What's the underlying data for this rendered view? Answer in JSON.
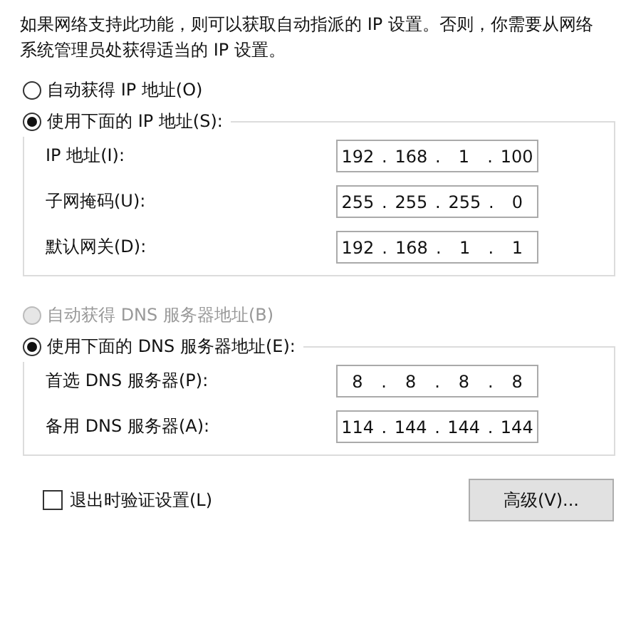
{
  "intro": "如果网络支持此功能，则可以获取自动指派的 IP 设置。否则，你需要从网络系统管理员处获得适当的 IP 设置。",
  "sections": [
    {
      "auto_option": {
        "label": "自动获得 IP 地址(O)",
        "selected": false,
        "disabled": false
      },
      "manual_option": {
        "label": "使用下面的 IP 地址(S):",
        "selected": true,
        "disabled": false
      },
      "fields": [
        {
          "label": "IP 地址(I):",
          "parts": [
            "192",
            ".",
            "168",
            ".",
            "1",
            ".",
            "100"
          ]
        },
        {
          "label": "子网掩码(U):",
          "parts": [
            "255",
            ".",
            "255",
            ".",
            "255",
            ".",
            "0"
          ]
        },
        {
          "label": "默认网关(D):",
          "parts": [
            "192",
            ".",
            "168",
            ".",
            "1",
            ".",
            "1"
          ]
        }
      ]
    },
    {
      "auto_option": {
        "label": "自动获得 DNS 服务器地址(B)",
        "selected": false,
        "disabled": true
      },
      "manual_option": {
        "label": "使用下面的 DNS 服务器地址(E):",
        "selected": true,
        "disabled": false
      },
      "fields": [
        {
          "label": "首选 DNS 服务器(P):",
          "parts": [
            "8",
            ".",
            "8",
            ".",
            "8",
            ".",
            "8"
          ]
        },
        {
          "label": "备用 DNS 服务器(A):",
          "parts": [
            "114",
            ".",
            "144",
            ".",
            "144",
            ".",
            "144"
          ]
        }
      ]
    }
  ],
  "validate_checkbox": {
    "label": "退出时验证设置(L)",
    "checked": false
  },
  "advanced_button": "高级(V)..."
}
